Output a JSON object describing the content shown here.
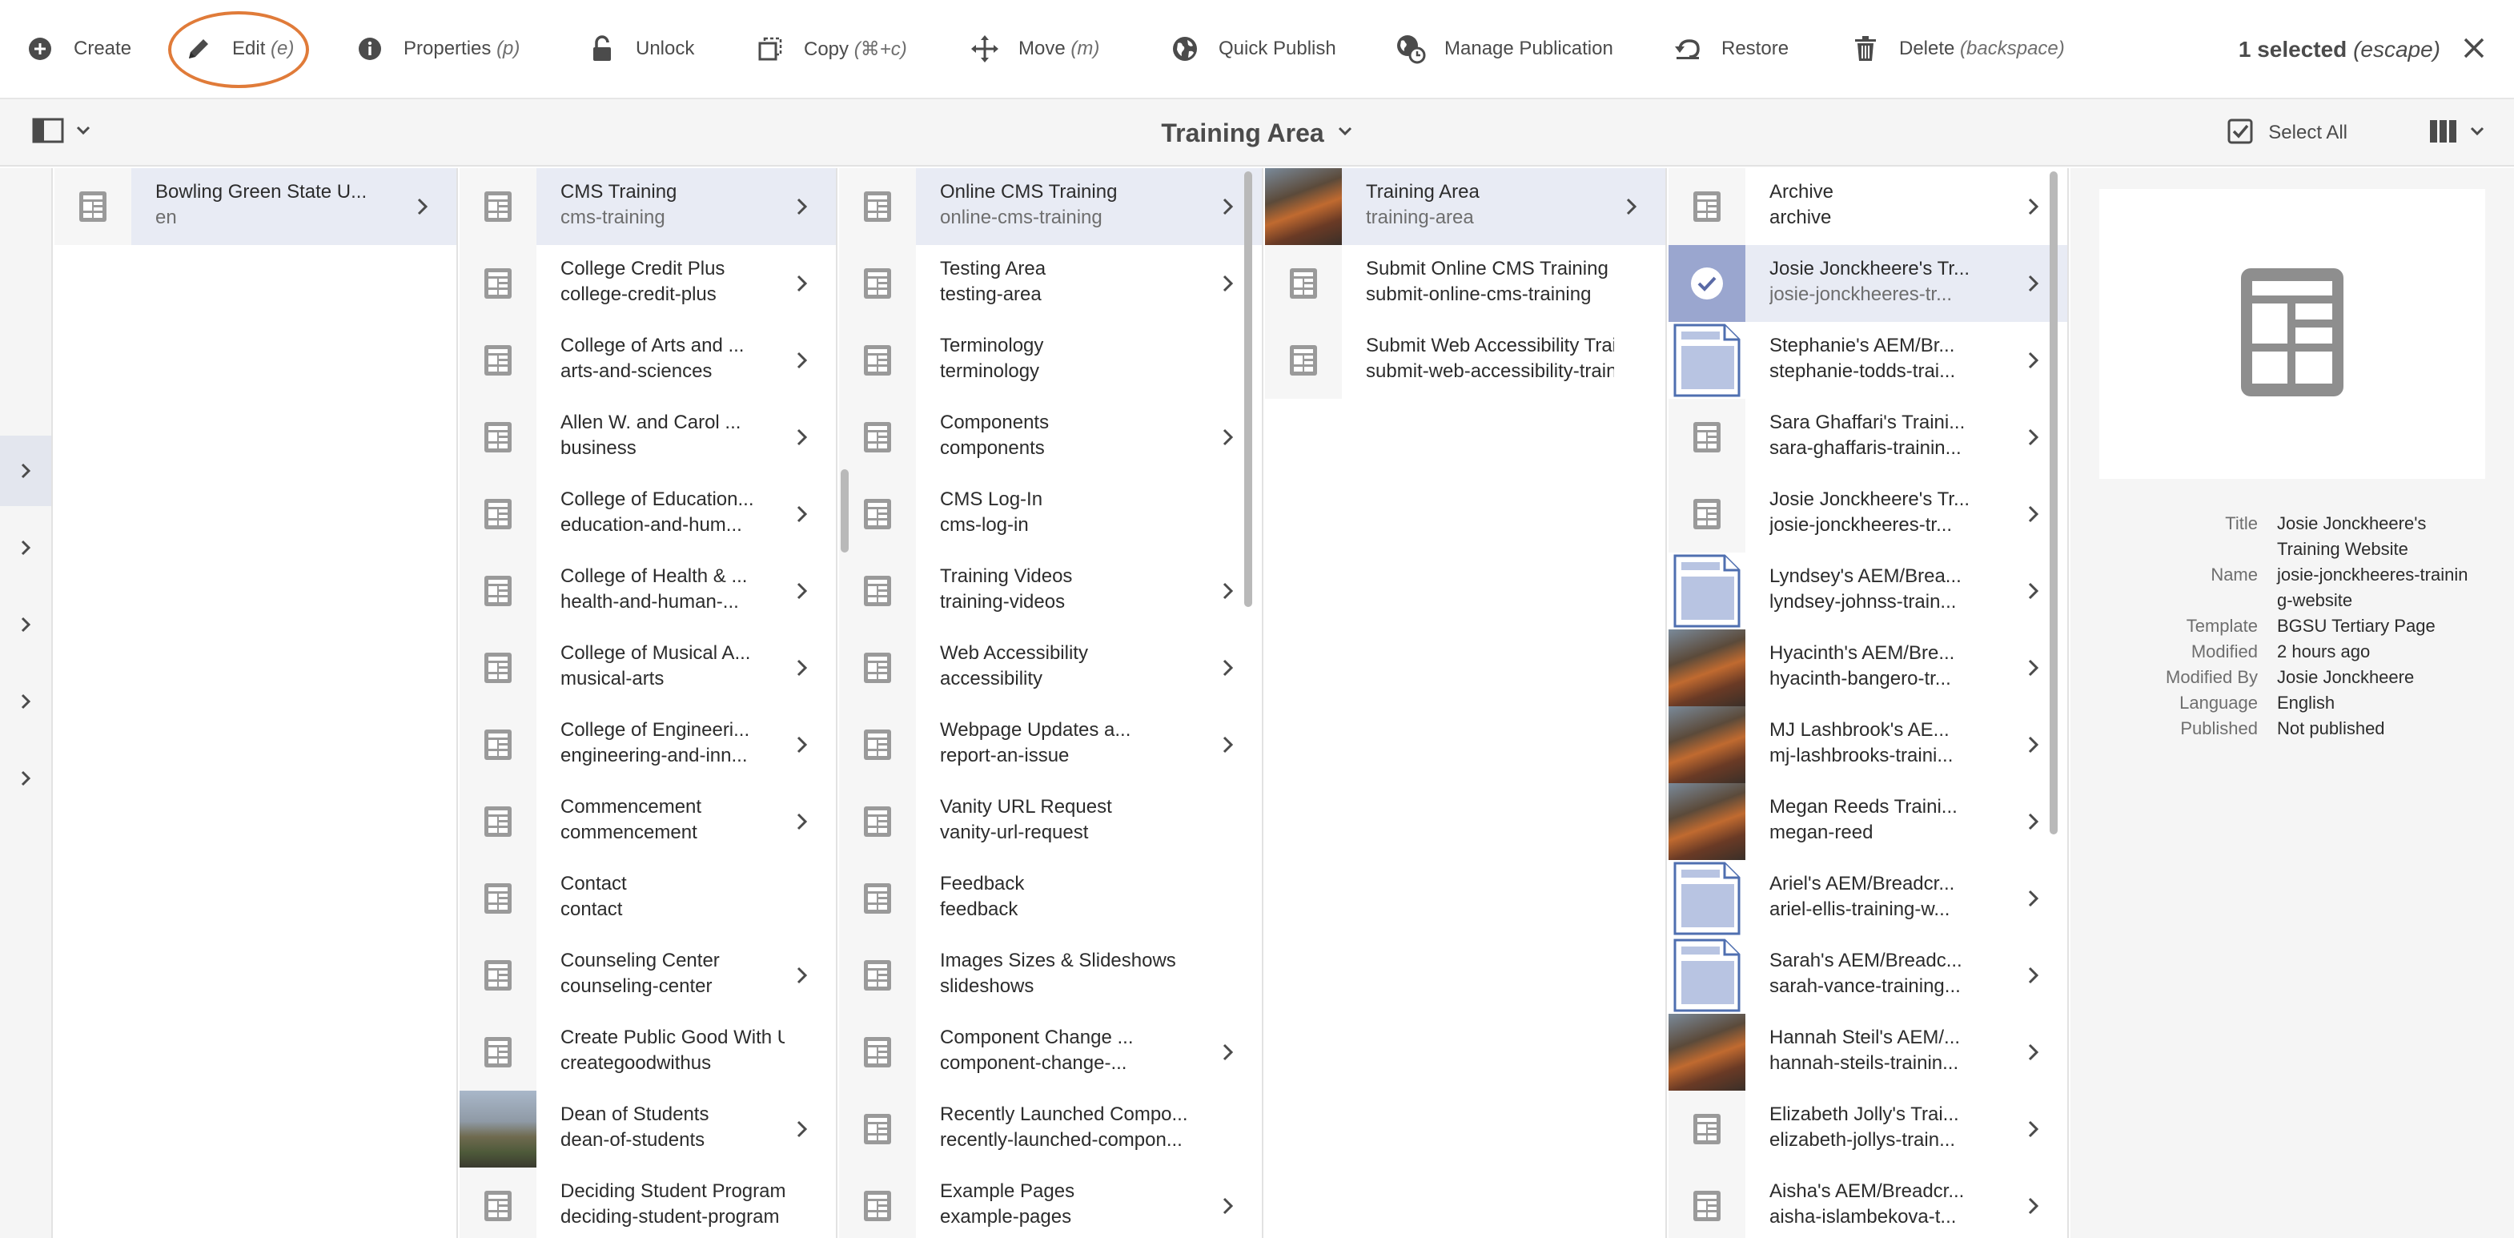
{
  "actionbar": {
    "create": "Create",
    "edit": "Edit",
    "edit_key": "(e)",
    "properties": "Properties",
    "properties_key": "(p)",
    "unlock": "Unlock",
    "copy": "Copy",
    "copy_key": "(⌘+c)",
    "move": "Move",
    "move_key": "(m)",
    "quick_publish": "Quick Publish",
    "manage_publication": "Manage Publication",
    "restore": "Restore",
    "delete": "Delete",
    "delete_key": "(backspace)",
    "selected_count": "1 selected",
    "selected_key": "(escape)"
  },
  "header": {
    "title": "Training Area",
    "select_all": "Select All"
  },
  "columns": [
    {
      "items": [
        {
          "title": "Bowling Green State U...",
          "name": "en",
          "active": true,
          "chevron": true,
          "thumb": "page"
        }
      ]
    },
    {
      "items": [
        {
          "title": "CMS Training",
          "name": "cms-training",
          "active": true,
          "chevron": true,
          "thumb": "page"
        },
        {
          "title": "College Credit Plus",
          "name": "college-credit-plus",
          "chevron": true,
          "thumb": "page"
        },
        {
          "title": "College of Arts and ...",
          "name": "arts-and-sciences",
          "chevron": true,
          "thumb": "page"
        },
        {
          "title": "Allen W. and Carol ...",
          "name": "business",
          "chevron": true,
          "thumb": "page"
        },
        {
          "title": "College of Education...",
          "name": "education-and-hum...",
          "chevron": true,
          "thumb": "page"
        },
        {
          "title": "College of Health & ...",
          "name": "health-and-human-...",
          "chevron": true,
          "thumb": "page"
        },
        {
          "title": "College of Musical A...",
          "name": "musical-arts",
          "chevron": true,
          "thumb": "page"
        },
        {
          "title": "College of Engineeri...",
          "name": "engineering-and-inn...",
          "chevron": true,
          "thumb": "page"
        },
        {
          "title": "Commencement",
          "name": "commencement",
          "chevron": true,
          "thumb": "page"
        },
        {
          "title": "Contact",
          "name": "contact",
          "chevron": false,
          "thumb": "page"
        },
        {
          "title": "Counseling Center",
          "name": "counseling-center",
          "chevron": true,
          "thumb": "page"
        },
        {
          "title": "Create Public Good With Us",
          "name": "creategoodwithus",
          "chevron": false,
          "thumb": "page"
        },
        {
          "title": "Dean of Students",
          "name": "dean-of-students",
          "chevron": true,
          "thumb": "photo2"
        },
        {
          "title": "Deciding Student Program",
          "name": "deciding-student-program",
          "chevron": false,
          "thumb": "page"
        }
      ]
    },
    {
      "items": [
        {
          "title": "Online CMS Training",
          "name": "online-cms-training",
          "active": true,
          "chevron": true,
          "thumb": "page"
        },
        {
          "title": "Testing Area",
          "name": "testing-area",
          "chevron": true,
          "thumb": "page"
        },
        {
          "title": "Terminology",
          "name": "terminology",
          "chevron": false,
          "thumb": "page"
        },
        {
          "title": "Components",
          "name": "components",
          "chevron": true,
          "thumb": "page"
        },
        {
          "title": "CMS Log-In",
          "name": "cms-log-in",
          "chevron": false,
          "thumb": "page"
        },
        {
          "title": "Training Videos",
          "name": "training-videos",
          "chevron": true,
          "thumb": "page"
        },
        {
          "title": "Web Accessibility",
          "name": "accessibility",
          "chevron": true,
          "thumb": "page"
        },
        {
          "title": "Webpage Updates a...",
          "name": "report-an-issue",
          "chevron": true,
          "thumb": "page"
        },
        {
          "title": "Vanity URL Request",
          "name": "vanity-url-request",
          "chevron": false,
          "thumb": "page"
        },
        {
          "title": "Feedback",
          "name": "feedback",
          "chevron": false,
          "thumb": "page"
        },
        {
          "title": "Images Sizes & Slideshows",
          "name": "slideshows",
          "chevron": false,
          "thumb": "page"
        },
        {
          "title": "Component Change ...",
          "name": "component-change-...",
          "chevron": true,
          "thumb": "page"
        },
        {
          "title": "Recently Launched Compo...",
          "name": "recently-launched-compon...",
          "chevron": false,
          "thumb": "page"
        },
        {
          "title": "Example Pages",
          "name": "example-pages",
          "chevron": true,
          "thumb": "page"
        }
      ]
    },
    {
      "items": [
        {
          "title": "Training Area",
          "name": "training-area",
          "active": true,
          "chevron": true,
          "thumb": "photo"
        },
        {
          "title": "Submit Online CMS Training",
          "name": "submit-online-cms-training",
          "chevron": false,
          "thumb": "page"
        },
        {
          "title": "Submit Web Accessibility Train...",
          "name": "submit-web-accessibility-traini...",
          "chevron": false,
          "thumb": "page"
        }
      ]
    },
    {
      "items": [
        {
          "title": "Archive",
          "name": "archive",
          "chevron": true,
          "thumb": "page"
        },
        {
          "title": "Josie Jonckheere's Tr...",
          "name": "josie-jonckheeres-tr...",
          "active": true,
          "chevron": true,
          "thumb": "check"
        },
        {
          "title": "Stephanie's AEM/Br...",
          "name": "stephanie-todds-trai...",
          "chevron": true,
          "thumb": "doc"
        },
        {
          "title": "Sara Ghaffari's Traini...",
          "name": "sara-ghaffaris-trainin...",
          "chevron": true,
          "thumb": "page"
        },
        {
          "title": "Josie Jonckheere's Tr...",
          "name": "josie-jonckheeres-tr...",
          "chevron": true,
          "thumb": "page"
        },
        {
          "title": "Lyndsey's AEM/Brea...",
          "name": "lyndsey-johnss-train...",
          "chevron": true,
          "thumb": "doc"
        },
        {
          "title": "Hyacinth's AEM/Bre...",
          "name": "hyacinth-bangero-tr...",
          "chevron": true,
          "thumb": "photo"
        },
        {
          "title": "MJ Lashbrook's AE...",
          "name": "mj-lashbrooks-traini...",
          "chevron": true,
          "thumb": "photo"
        },
        {
          "title": "Megan Reeds Traini...",
          "name": "megan-reed",
          "chevron": true,
          "thumb": "photo"
        },
        {
          "title": "Ariel's AEM/Breadcr...",
          "name": "ariel-ellis-training-w...",
          "chevron": true,
          "thumb": "doc"
        },
        {
          "title": "Sarah's AEM/Breadc...",
          "name": "sarah-vance-training...",
          "chevron": true,
          "thumb": "doc"
        },
        {
          "title": "Hannah Steil's AEM/...",
          "name": "hannah-steils-trainin...",
          "chevron": true,
          "thumb": "photo"
        },
        {
          "title": "Elizabeth Jolly's Trai...",
          "name": "elizabeth-jollys-train...",
          "chevron": true,
          "thumb": "page"
        },
        {
          "title": "Aisha's AEM/Breadcr...",
          "name": "aisha-islambekova-t...",
          "chevron": true,
          "thumb": "page"
        }
      ]
    }
  ],
  "detail": {
    "title_label": "Title",
    "title_value": "Josie Jonckheere's Training Website",
    "name_label": "Name",
    "name_value": "josie-jonckheeres-training-website",
    "template_label": "Template",
    "template_value": "BGSU Tertiary Page",
    "modified_label": "Modified",
    "modified_value": "2 hours ago",
    "modified_by_label": "Modified By",
    "modified_by_value": "Josie Jonckheere",
    "language_label": "Language",
    "language_value": "English",
    "published_label": "Published",
    "published_value": "Not published"
  },
  "colors": {
    "accent_ring": "#e07b39",
    "active_row": "#e8ebf4",
    "icon": "#4b4b4b"
  }
}
